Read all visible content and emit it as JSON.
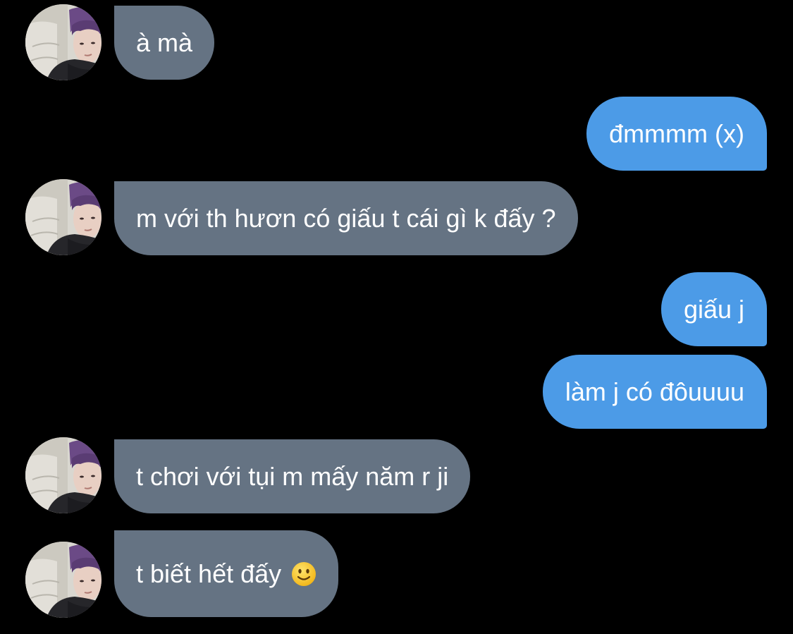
{
  "conversation": {
    "messages": [
      {
        "direction": "incoming",
        "text": "à mà"
      },
      {
        "direction": "outgoing",
        "text": "đmmmm (x)"
      },
      {
        "direction": "incoming",
        "text": "m với th hươn có giấu t cái gì k đấy ?"
      },
      {
        "direction": "outgoing",
        "text": "giấu j"
      },
      {
        "direction": "outgoing",
        "text": "làm j có đôuuuu"
      },
      {
        "direction": "incoming",
        "text": "t chơi với tụi m mấy năm r ji"
      },
      {
        "direction": "incoming",
        "text": "t biết hết đấy",
        "emoji": "slightly-smiling-face-icon"
      }
    ]
  },
  "theme": {
    "background": "#000000",
    "incoming_bubble": "#657383",
    "outgoing_bubble": "#4c9be7",
    "text": "#ffffff"
  }
}
